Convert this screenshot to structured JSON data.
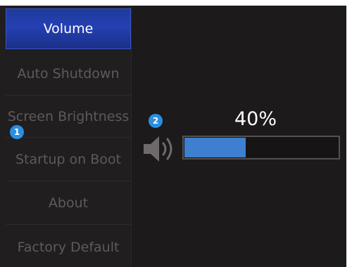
{
  "menu": {
    "items": [
      {
        "label": "Volume"
      },
      {
        "label": "Auto Shutdown"
      },
      {
        "label": "Screen Brightness"
      },
      {
        "label": "Startup on Boot"
      },
      {
        "label": "About"
      },
      {
        "label": "Factory Default"
      }
    ],
    "active_index": 0
  },
  "volume": {
    "level_text": "40%",
    "level_fraction": 0.4
  },
  "callouts": {
    "menu_badge": "1",
    "volume_badge": "2"
  },
  "icons": {
    "speaker": "speaker-icon"
  },
  "colors": {
    "accent": "#2440b2",
    "bar_fill": "#3e7fd0",
    "badge": "#2b8fe0"
  }
}
